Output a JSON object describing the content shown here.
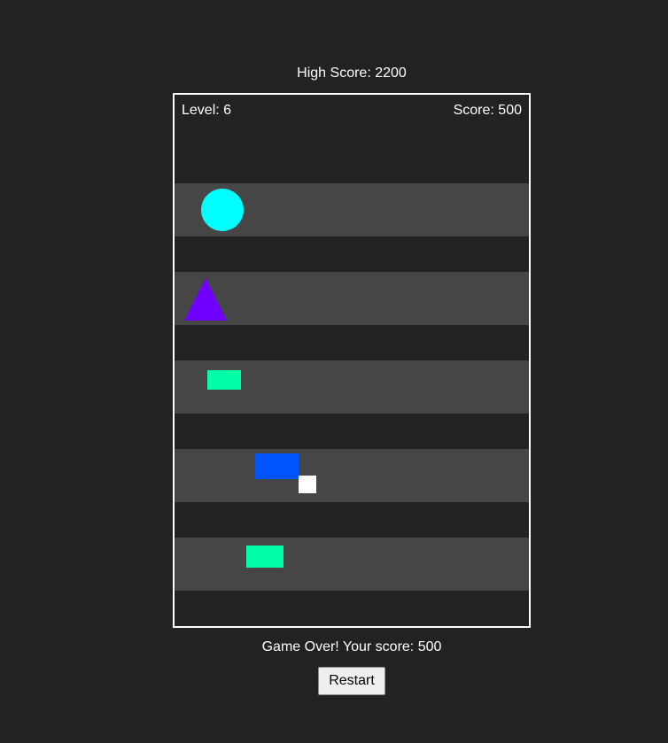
{
  "high_score": {
    "text": "High Score: 2200",
    "value": 2200
  },
  "hud": {
    "level_text": "Level: 6",
    "level": 6,
    "score_text": "Score: 500",
    "score": 500
  },
  "obstacles": [
    {
      "lane": 1,
      "shape": "circle",
      "color": "#00ffff"
    },
    {
      "lane": 2,
      "shape": "triangle",
      "color": "#7000ff"
    },
    {
      "lane": 3,
      "shape": "rectangle",
      "color": "#00ffa6"
    },
    {
      "lane": 4,
      "shape": "rectangle",
      "color": "#0055ff"
    },
    {
      "lane": 5,
      "shape": "rectangle",
      "color": "#00ffa6"
    }
  ],
  "player": {
    "color": "#ffffff"
  },
  "game_over": {
    "text": "Game Over! Your score: 500"
  },
  "restart_button": {
    "label": "Restart"
  },
  "colors": {
    "background": "#222222",
    "lane": "#464646",
    "border": "#ffffff",
    "text": "#ffffff"
  }
}
